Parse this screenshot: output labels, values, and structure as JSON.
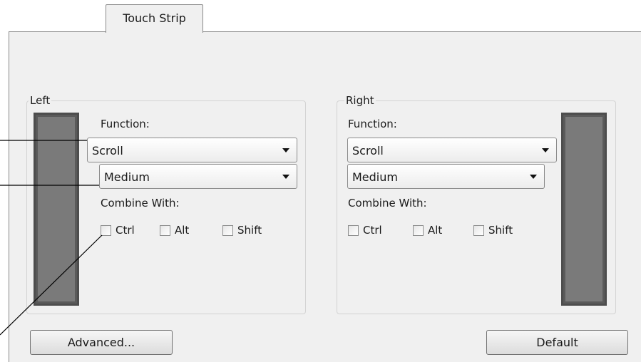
{
  "tabs": {
    "active": "Touch Strip"
  },
  "left": {
    "group_title": "Left",
    "function_label": "Function:",
    "function_value": "Scroll",
    "speed_value": "Medium",
    "combine_label": "Combine With:",
    "modifiers": [
      "Ctrl",
      "Alt",
      "Shift"
    ]
  },
  "right": {
    "group_title": "Right",
    "function_label": "Function:",
    "function_value": "Scroll",
    "speed_value": "Medium",
    "combine_label": "Combine With:",
    "modifiers": [
      "Ctrl",
      "Alt",
      "Shift"
    ]
  },
  "buttons": {
    "advanced": "Advanced...",
    "default": "Default"
  }
}
